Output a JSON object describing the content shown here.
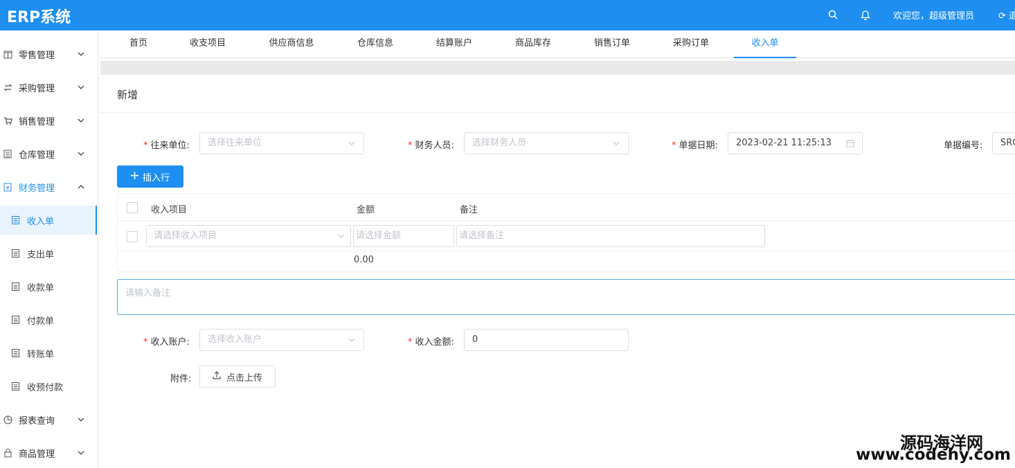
{
  "app": {
    "brand": "ERP系统",
    "welcome": "欢迎您，超级管理员",
    "logout": "退"
  },
  "icons": {
    "search": "search-icon",
    "bell": "bell-icon",
    "logout": "logout-icon"
  },
  "colors": {
    "primary": "#1e8ff0",
    "required": "#e53935"
  },
  "sidebar": {
    "menus": [
      {
        "label": "零售管理",
        "icon": "retail-icon"
      },
      {
        "label": "采购管理",
        "icon": "purchase-icon"
      },
      {
        "label": "销售管理",
        "icon": "cart-icon"
      },
      {
        "label": "仓库管理",
        "icon": "warehouse-icon"
      },
      {
        "label": "财务管理",
        "icon": "finance-icon"
      }
    ],
    "finance_items": [
      {
        "label": "收入单",
        "active": true
      },
      {
        "label": "支出单"
      },
      {
        "label": "收款单"
      },
      {
        "label": "付款单"
      },
      {
        "label": "转账单"
      },
      {
        "label": "收预付款"
      }
    ],
    "menus_after": [
      {
        "label": "报表查询",
        "icon": "chart-icon"
      },
      {
        "label": "商品管理",
        "icon": "goods-icon"
      }
    ]
  },
  "tabs": [
    "首页",
    "收支项目",
    "供应商信息",
    "仓库信息",
    "结算账户",
    "商品库存",
    "销售订单",
    "采购订单",
    "收入单"
  ],
  "form": {
    "title": "新增",
    "partner_label": "往来单位:",
    "partner_placeholder": "选择往来单位",
    "staff_label": "财务人员:",
    "staff_placeholder": "选择财务人员",
    "date_label": "单据日期:",
    "date_value": "2023-02-21 11:25:13",
    "number_label": "单据编号:",
    "number_value": "SRO",
    "insert_row": "插入行",
    "remark_placeholder": "请输入备注",
    "account_label": "收入账户:",
    "account_placeholder": "选择收入账户",
    "amount_label": "收入金额:",
    "amount_value": "0",
    "attach_label": "附件:",
    "upload_label": "点击上传"
  },
  "table": {
    "headers": [
      "收入项目",
      "金额",
      "备注"
    ],
    "row": {
      "item_placeholder": "请选择收入项目",
      "amount_placeholder": "请选择金额",
      "remark_placeholder": "请选择备注"
    },
    "total": "0.00"
  },
  "watermark": {
    "title": "源码海洋网",
    "url": "www.codehy.com"
  }
}
